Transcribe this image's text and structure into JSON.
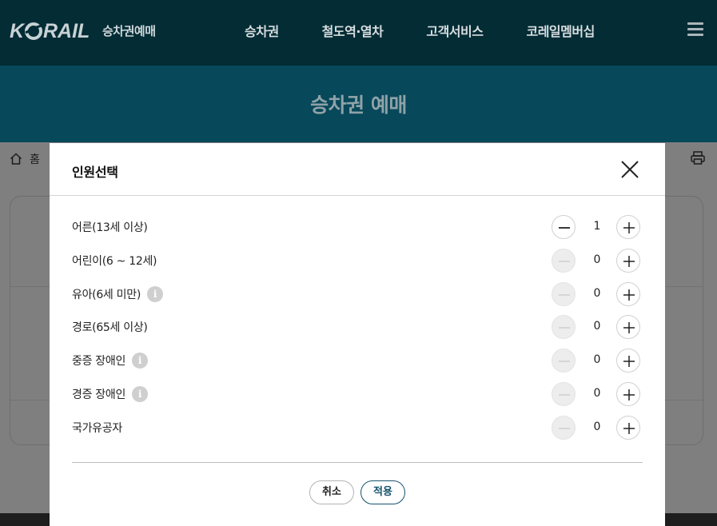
{
  "header": {
    "logo_text": "KORAIL",
    "logo_sub": "승차권예매",
    "nav": [
      "승차권",
      "철도역·열차",
      "고객서비스",
      "코레일멤버십"
    ]
  },
  "banner": {
    "title": "승차권 예매"
  },
  "breadcrumb": {
    "home_label": "홈"
  },
  "modal": {
    "title": "인원선택",
    "rows": [
      {
        "label": "어른(13세 이상)",
        "count": "1",
        "info": false,
        "minus_enabled": true
      },
      {
        "label": "어린이(6 ~ 12세)",
        "count": "0",
        "info": false,
        "minus_enabled": false
      },
      {
        "label": "유아(6세 미만)",
        "count": "0",
        "info": true,
        "minus_enabled": false
      },
      {
        "label": "경로(65세 이상)",
        "count": "0",
        "info": false,
        "minus_enabled": false
      },
      {
        "label": "중증 장애인",
        "count": "0",
        "info": true,
        "minus_enabled": false
      },
      {
        "label": "경증 장애인",
        "count": "0",
        "info": true,
        "minus_enabled": false
      },
      {
        "label": "국가유공자",
        "count": "0",
        "info": false,
        "minus_enabled": false
      }
    ],
    "cancel_label": "취소",
    "apply_label": "적용"
  },
  "colors": {
    "header_bg": "#032c35",
    "banner_bg": "#07485a",
    "accent": "#17536d",
    "overlay": "#7f7f7f"
  }
}
